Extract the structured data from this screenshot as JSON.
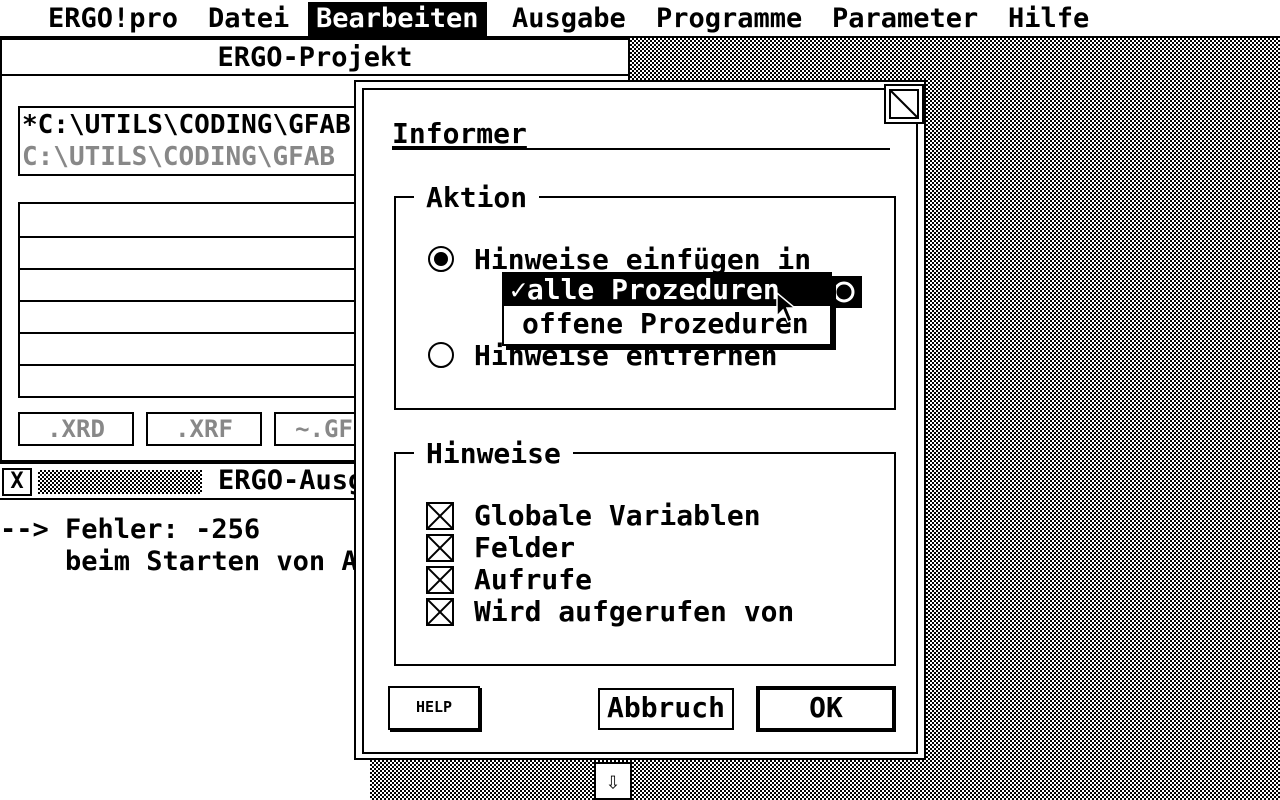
{
  "menubar": {
    "items": [
      {
        "label": "ERGO!pro",
        "active": false
      },
      {
        "label": "Datei",
        "active": false
      },
      {
        "label": "Bearbeiten",
        "active": true
      },
      {
        "label": "Ausgabe",
        "active": false
      },
      {
        "label": "Programme",
        "active": false
      },
      {
        "label": "Parameter",
        "active": false
      },
      {
        "label": "Hilfe",
        "active": false
      }
    ]
  },
  "project_window": {
    "title": "ERGO-Projekt",
    "paths": [
      "*C:\\UTILS\\CODING\\GFAB",
      " C:\\UTILS\\CODING\\GFAB"
    ],
    "buttons": [
      ".XRD",
      ".XRF",
      "~.GF"
    ]
  },
  "output_window": {
    "close_glyph": "X",
    "title": "ERGO-Ausg",
    "lines": [
      "--> Fehler: -256",
      "    beim Starten von A"
    ]
  },
  "dialog": {
    "title": "Informer",
    "group_action": {
      "title": "Aktion",
      "radio_insert": {
        "label": "Hinweise einfügen in",
        "selected": true
      },
      "radio_remove": {
        "label": "Hinweise entfernen",
        "selected": false
      }
    },
    "popup": {
      "items": [
        {
          "label": "✓alle Prozeduren",
          "selected": true
        },
        {
          "label": " offene Prozeduren",
          "selected": false
        }
      ]
    },
    "group_hints": {
      "title": "Hinweise",
      "checkboxes": [
        {
          "label": "Globale Variablen",
          "checked": true
        },
        {
          "label": "Felder",
          "checked": true
        },
        {
          "label": "Aufrufe",
          "checked": true
        },
        {
          "label": "Wird aufgerufen von",
          "checked": true
        }
      ]
    },
    "buttons": {
      "help": "HELP",
      "cancel": "Abbruch",
      "ok": "OK"
    }
  },
  "scroll_arrow": "⇩"
}
